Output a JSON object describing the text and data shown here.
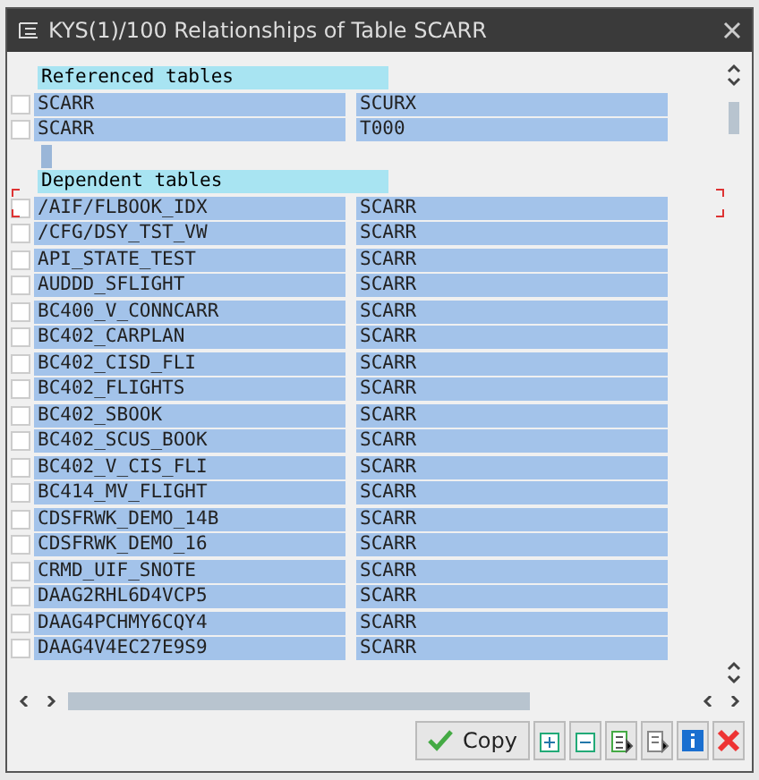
{
  "window": {
    "title": "KYS(1)/100 Relationships of Table SCARR"
  },
  "sections": [
    {
      "header": "Referenced tables",
      "rows": [
        {
          "checked": false,
          "column_1": "SCARR",
          "column_2": "SCURX"
        },
        {
          "checked": false,
          "column_1": "SCARR",
          "column_2": "T000"
        }
      ]
    },
    {
      "header": "Dependent tables",
      "rows": [
        {
          "checked": false,
          "column_1": "/AIF/FLBOOK_IDX",
          "column_2": "SCARR"
        },
        {
          "checked": false,
          "column_1": "/CFG/DSY_TST_VW",
          "column_2": "SCARR"
        },
        {
          "checked": false,
          "column_1": "API_STATE_TEST",
          "column_2": "SCARR"
        },
        {
          "checked": false,
          "column_1": "AUDDD_SFLIGHT",
          "column_2": "SCARR"
        },
        {
          "checked": false,
          "column_1": "BC400_V_CONNCARR",
          "column_2": "SCARR"
        },
        {
          "checked": false,
          "column_1": "BC402_CARPLAN",
          "column_2": "SCARR"
        },
        {
          "checked": false,
          "column_1": "BC402_CISD_FLI",
          "column_2": "SCARR"
        },
        {
          "checked": false,
          "column_1": "BC402_FLIGHTS",
          "column_2": "SCARR"
        },
        {
          "checked": false,
          "column_1": "BC402_SBOOK",
          "column_2": "SCARR"
        },
        {
          "checked": false,
          "column_1": "BC402_SCUS_BOOK",
          "column_2": "SCARR"
        },
        {
          "checked": false,
          "column_1": "BC402_V_CIS_FLI",
          "column_2": "SCARR"
        },
        {
          "checked": false,
          "column_1": "BC414_MV_FLIGHT",
          "column_2": "SCARR"
        },
        {
          "checked": false,
          "column_1": "CDSFRWK_DEMO_14B",
          "column_2": "SCARR"
        },
        {
          "checked": false,
          "column_1": "CDSFRWK_DEMO_16",
          "column_2": "SCARR"
        },
        {
          "checked": false,
          "column_1": "CRMD_UIF_SNOTE",
          "column_2": "SCARR"
        },
        {
          "checked": false,
          "column_1": "DAAG2RHL6D4VCP5",
          "column_2": "SCARR"
        },
        {
          "checked": false,
          "column_1": "DAAG4PCHMY6CQY4",
          "column_2": "SCARR"
        },
        {
          "checked": false,
          "column_1": "DAAG4V4EC27E9S9",
          "column_2": "SCARR"
        }
      ]
    }
  ],
  "buttons": {
    "copy": "Copy"
  }
}
